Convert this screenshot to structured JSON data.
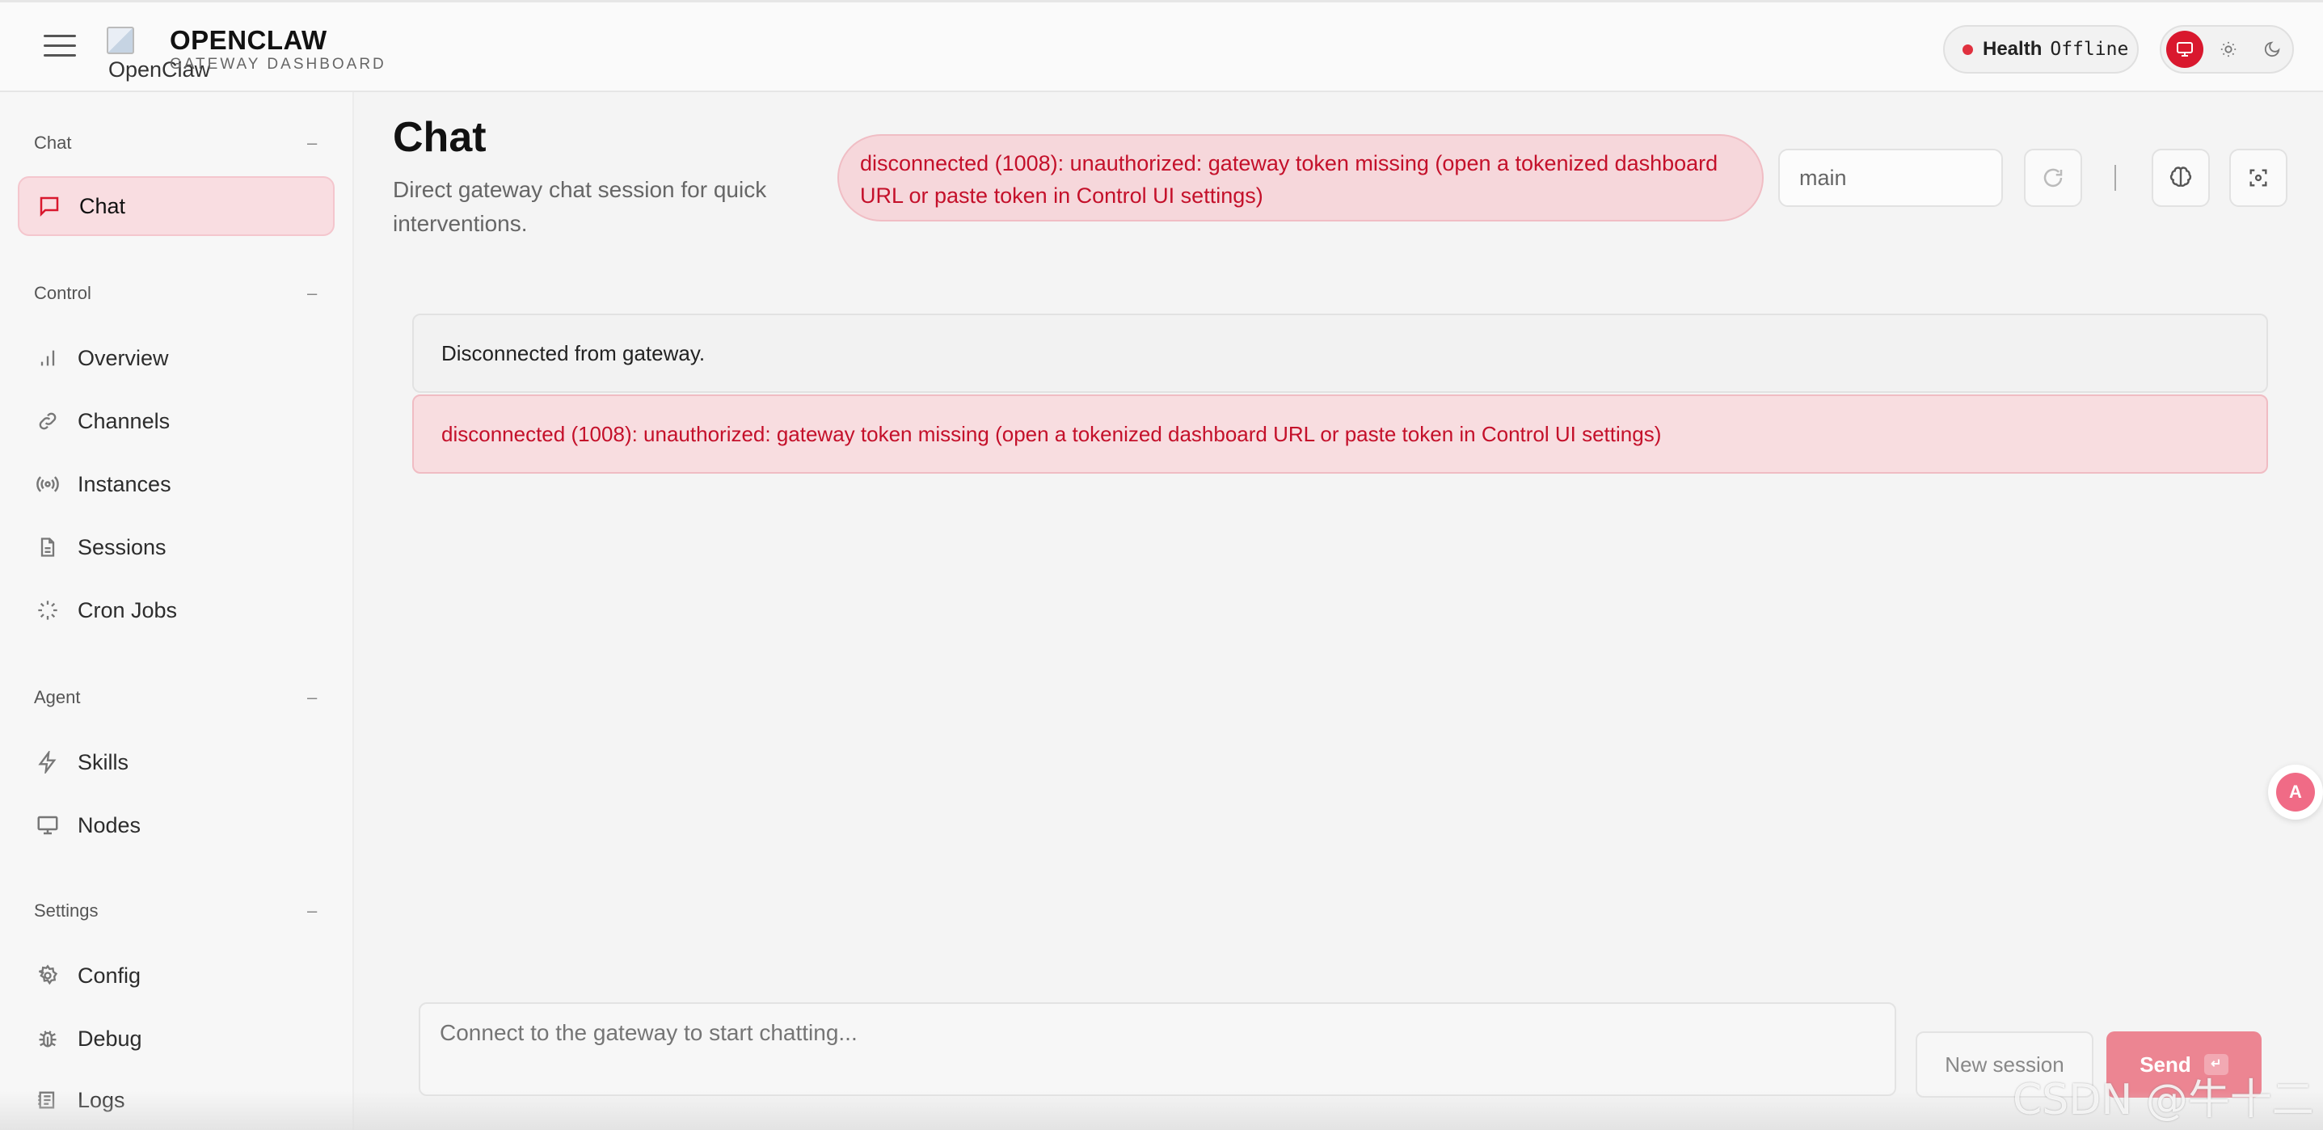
{
  "header": {
    "logo_alt": "OpenClaw",
    "brand_title": "OPENCLAW",
    "brand_subtitle": "GATEWAY DASHBOARD",
    "health_label": "Health",
    "health_status": "Offline",
    "theme_options": [
      "system-icon",
      "sun-icon",
      "moon-icon"
    ]
  },
  "sidebar": {
    "groups": [
      {
        "title": "Chat",
        "collapse": "–",
        "items": [
          {
            "label": "Chat",
            "icon": "chat-icon",
            "active": true
          }
        ]
      },
      {
        "title": "Control",
        "collapse": "–",
        "items": [
          {
            "label": "Overview",
            "icon": "bar-chart-icon"
          },
          {
            "label": "Channels",
            "icon": "link-icon"
          },
          {
            "label": "Instances",
            "icon": "radio-icon"
          },
          {
            "label": "Sessions",
            "icon": "document-icon"
          },
          {
            "label": "Cron Jobs",
            "icon": "loader-icon"
          }
        ]
      },
      {
        "title": "Agent",
        "collapse": "–",
        "items": [
          {
            "label": "Skills",
            "icon": "lightning-icon"
          },
          {
            "label": "Nodes",
            "icon": "monitor-icon"
          }
        ]
      },
      {
        "title": "Settings",
        "collapse": "–",
        "items": [
          {
            "label": "Config",
            "icon": "gear-icon"
          },
          {
            "label": "Debug",
            "icon": "bug-icon"
          },
          {
            "label": "Logs",
            "icon": "logs-icon"
          }
        ]
      }
    ]
  },
  "main": {
    "title": "Chat",
    "subtitle": "Direct gateway chat session for quick interventions.",
    "error_banner": "disconnected (1008): unauthorized: gateway token missing (open a tokenized dashboard URL or paste token in Control UI settings)",
    "session_value": "main",
    "messages": [
      {
        "kind": "neutral",
        "text": "Disconnected from gateway."
      },
      {
        "kind": "error",
        "text": "disconnected (1008): unauthorized: gateway token missing (open a tokenized dashboard URL or paste token in Control UI settings)"
      }
    ],
    "composer_placeholder": "Connect to the gateway to start chatting...",
    "new_session_label": "New session",
    "send_label": "Send",
    "send_shortcut": "↵"
  },
  "overlay": {
    "translate_label": "A",
    "watermark": "CSDN @牛十二"
  },
  "colors": {
    "accent": "#d9182e",
    "error_text": "#c4102a",
    "error_bg": "#f6d7db",
    "active_nav_bg": "#f9dde1"
  }
}
